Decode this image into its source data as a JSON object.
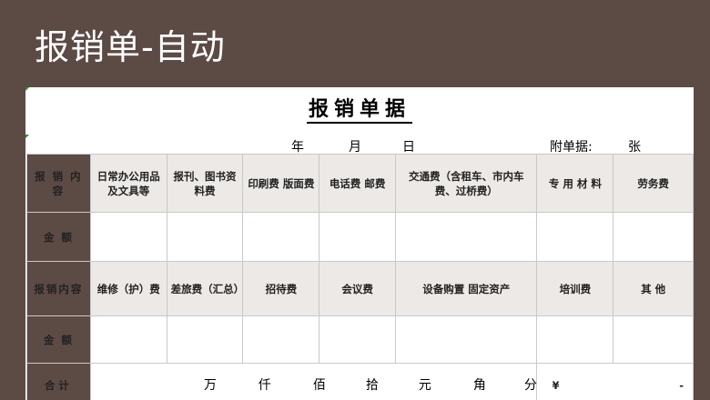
{
  "app": {
    "title": "报销单-自动"
  },
  "document": {
    "title": "报销单据",
    "year_label": "年",
    "month_label": "月",
    "day_label": "日",
    "attachments_label": "附单据:",
    "sheets_label": "张"
  },
  "table": {
    "row1_label": "报 销 内 容",
    "row1_items": [
      "日常办公用品及文具等",
      "报刊、图书资料费",
      "印刷费 版面费",
      "电话费 邮费",
      "交通费（含租车、市内车费、过桥费）",
      "专 用 材 料",
      "劳务费"
    ],
    "amount_label": "金 额",
    "row3_label": "报销内容",
    "row3_items": [
      "维修（护）费",
      "差旅费（汇总）",
      "招待费",
      "会议费",
      "设备购置 固定资产",
      "培训费",
      "其  他"
    ],
    "total_label": "合计",
    "total_units": [
      "万",
      "仟",
      "佰",
      "拾",
      "元",
      "角",
      "分"
    ],
    "currency_symbol": "¥",
    "total_value": "-"
  }
}
